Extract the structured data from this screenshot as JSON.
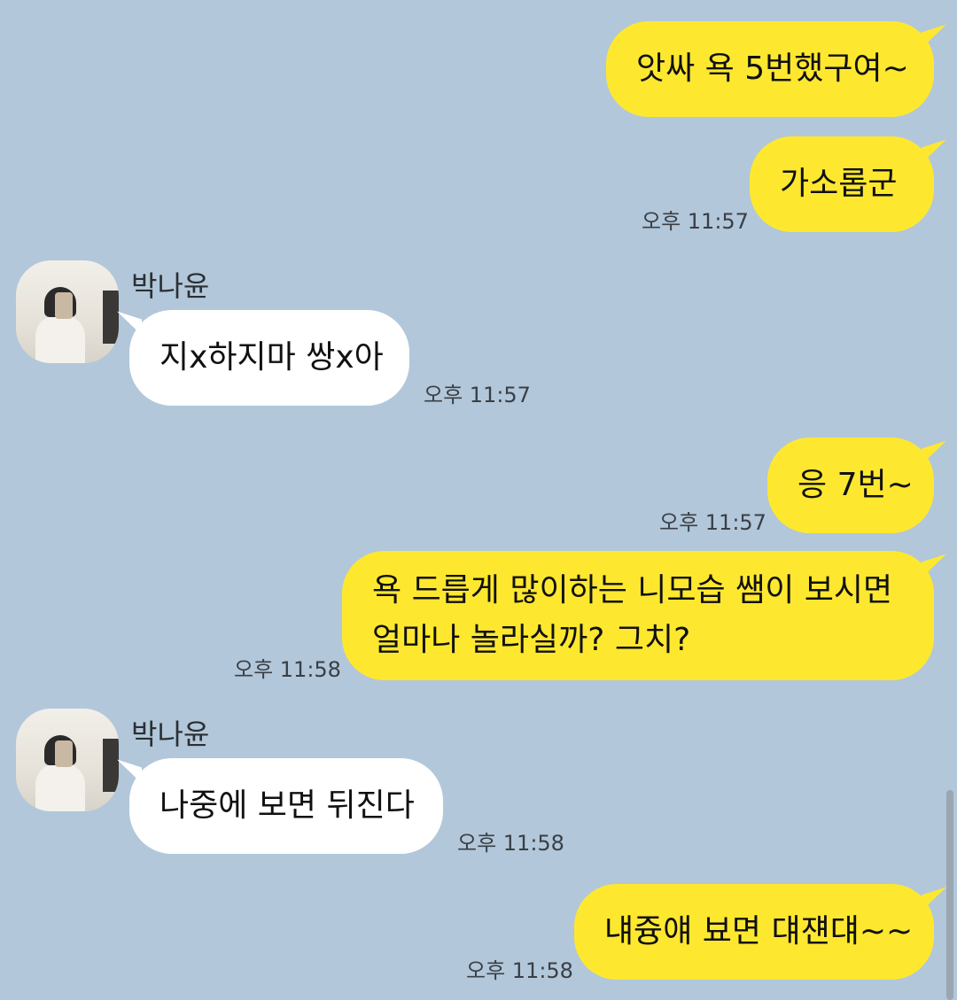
{
  "messages": [
    {
      "text": "앗싸 욕 5번했구여~"
    },
    {
      "text": "가소롭군",
      "time": "오후 11:57"
    },
    {
      "sender": "박나윤",
      "text": "지x하지마 쌍x아",
      "time": "오후 11:57"
    },
    {
      "text": "응 7번~",
      "time": "오후 11:57"
    },
    {
      "text": "욕 드릅게 많이하는 니모습 쌤이 보시면 얼마나 놀라실까? 그치?",
      "time": "오후 11:58"
    },
    {
      "sender": "박나윤",
      "text": "나중에 보면 뒤진다",
      "time": "오후 11:58"
    },
    {
      "text": "냬즁얘 뵤면 댸쟨댸~~",
      "time": "오후 11:58"
    }
  ],
  "colors": {
    "background": "#b2c7da",
    "my_bubble": "#fee82f",
    "other_bubble": "#ffffff"
  }
}
